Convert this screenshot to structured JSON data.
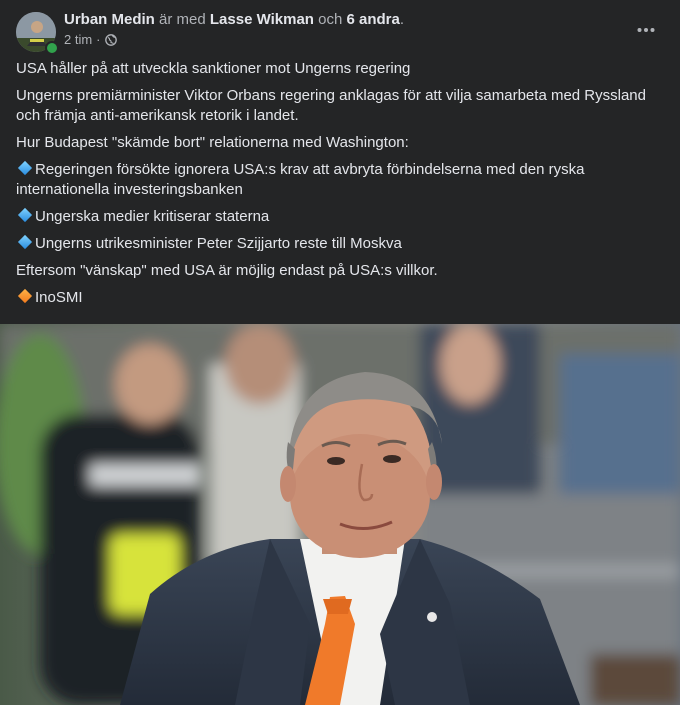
{
  "post": {
    "author": "Urban Medin",
    "with_text": "är med",
    "tagged_person": "Lasse Wikman",
    "and_text": "och",
    "others": "6 andra",
    "end_punct": ".",
    "time": "2 tim",
    "time_sep": "·",
    "audience_icon": "globe-icon"
  },
  "content": {
    "line1": "USA håller på att utveckla sanktioner mot Ungerns regering",
    "line2": "Ungerns premiärminister Viktor Orbans regering anklagas för att vilja samarbeta med Ryssland och främja anti-amerikansk retorik i landet.",
    "line3": "Hur Budapest \"skämde bort\" relationerna med Washington:",
    "bullets": [
      "Regeringen försökte ignorera USA:s krav att avbryta förbindelserna med den ryska internationella investeringsbanken",
      "Ungerska medier kritiserar staterna",
      "Ungerns utrikesminister Peter Szijjarto reste till Moskva"
    ],
    "line4": "Eftersom \"vänskap\" med USA är möjlig endast på USA:s villkor.",
    "source": "InoSMI"
  },
  "colors": {
    "background": "#242526",
    "text": "#e4e6eb",
    "muted": "#b0b3b8",
    "online": "#31a24c",
    "tie": "#f07a2a"
  }
}
